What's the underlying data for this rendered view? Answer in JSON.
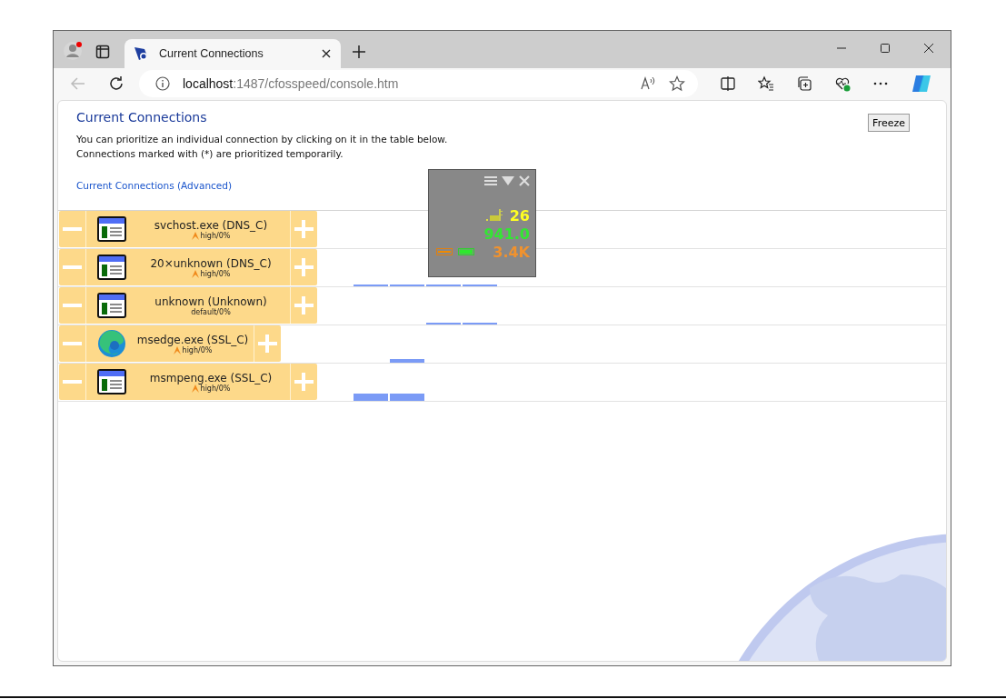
{
  "browser": {
    "tab_title": "Current Connections",
    "url_host": "localhost",
    "url_path": ":1487/cfosspeed/console.htm"
  },
  "page": {
    "title": "Current Connections",
    "intro": [
      "You can prioritize an individual connection by clicking on it in the table below.",
      "Connections marked with (*) are prioritized temporarily."
    ],
    "link": "Current Connections (Advanced)",
    "freeze_button": "Freeze"
  },
  "connections": [
    {
      "kind": "app",
      "name": "svchost.exe (DNS_C)",
      "priority": "high/0%",
      "flame": true
    },
    {
      "kind": "app",
      "name": "20×unknown (DNS_C)",
      "priority": "high/0%",
      "flame": true
    },
    {
      "kind": "app",
      "name": "unknown (Unknown)",
      "priority": "default/0%",
      "flame": false
    },
    {
      "kind": "edge",
      "name": "msedge.exe (SSL_C)",
      "priority": "high/0%",
      "flame": true
    },
    {
      "kind": "app",
      "name": "msmpeng.exe (SSL_C)",
      "priority": "high/0%",
      "flame": true
    }
  ],
  "widget": {
    "ping": "26",
    "download": "941.0",
    "upload": "3.4K"
  }
}
